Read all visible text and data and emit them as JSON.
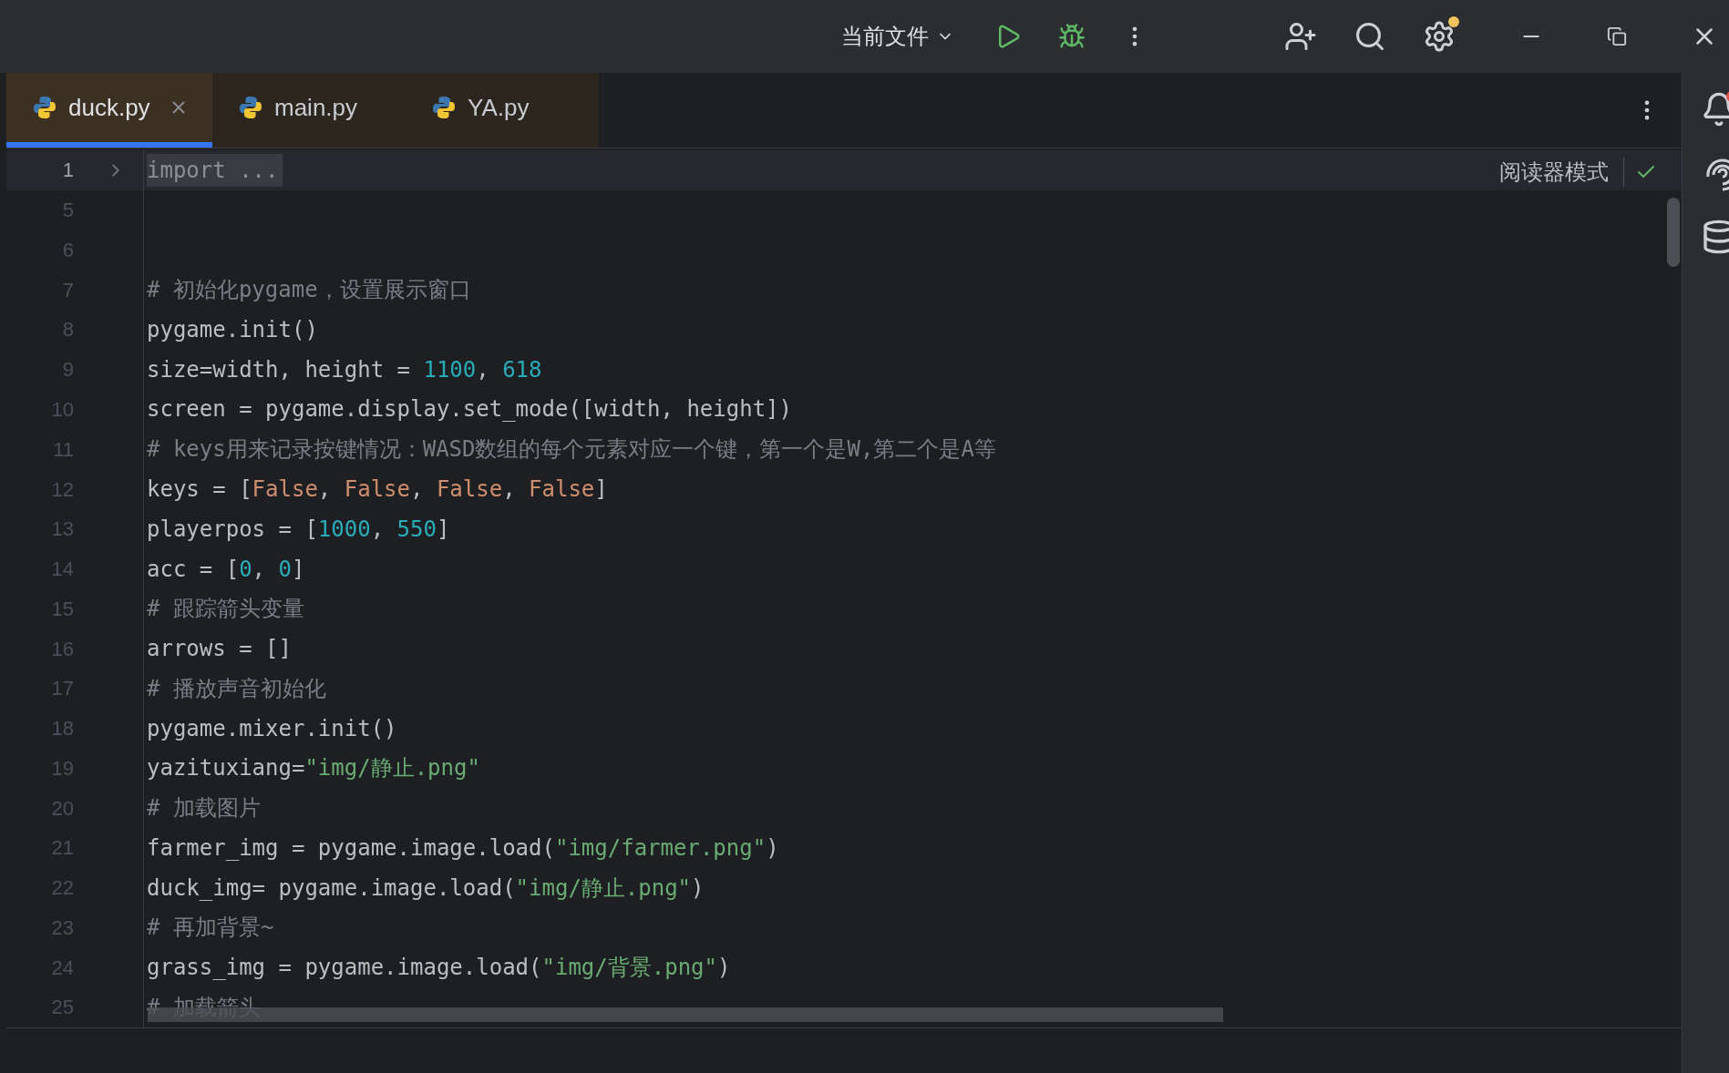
{
  "toolbar": {
    "run_config": "当前文件"
  },
  "tabs": [
    {
      "label": "duck.py",
      "selected": true
    },
    {
      "label": "main.py",
      "selected": false
    },
    {
      "label": "YA.py",
      "selected": false
    }
  ],
  "reader_mode": {
    "label": "阅读器模式"
  },
  "editor": {
    "lines": [
      {
        "number": "1",
        "current": true,
        "folded": true,
        "tokens": [
          {
            "kind": "folded",
            "text": "import ..."
          }
        ]
      },
      {
        "number": "5",
        "current": false,
        "folded": false
      },
      {
        "number": "6",
        "current": false,
        "folded": false
      },
      {
        "number": "7",
        "current": false,
        "folded": false,
        "tokens": [
          {
            "kind": "comment",
            "text": "# 初始化pygame，设置展示窗口"
          }
        ]
      },
      {
        "number": "8",
        "current": false,
        "folded": false,
        "tokens": [
          {
            "kind": "plain",
            "text": "pygame.init()"
          }
        ]
      },
      {
        "number": "9",
        "current": false,
        "folded": false,
        "tokens": [
          {
            "kind": "plain",
            "text": "size=width, height = "
          },
          {
            "kind": "number",
            "text": "1100"
          },
          {
            "kind": "plain",
            "text": ", "
          },
          {
            "kind": "number",
            "text": "618"
          }
        ]
      },
      {
        "number": "10",
        "current": false,
        "folded": false,
        "tokens": [
          {
            "kind": "plain",
            "text": "screen = pygame.display.set_mode([width, height])"
          }
        ]
      },
      {
        "number": "11",
        "current": false,
        "folded": false,
        "tokens": [
          {
            "kind": "comment",
            "text": "# keys用来记录按键情况：WASD数组的每个元素对应一个键，第一个是W,第二个是A等"
          }
        ]
      },
      {
        "number": "12",
        "current": false,
        "folded": false,
        "tokens": [
          {
            "kind": "plain",
            "text": "keys = ["
          },
          {
            "kind": "keyword",
            "text": "False"
          },
          {
            "kind": "plain",
            "text": ", "
          },
          {
            "kind": "keyword",
            "text": "False"
          },
          {
            "kind": "plain",
            "text": ", "
          },
          {
            "kind": "keyword",
            "text": "False"
          },
          {
            "kind": "plain",
            "text": ", "
          },
          {
            "kind": "keyword",
            "text": "False"
          },
          {
            "kind": "plain",
            "text": "]"
          }
        ]
      },
      {
        "number": "13",
        "current": false,
        "folded": false,
        "tokens": [
          {
            "kind": "plain",
            "text": "playerpos = ["
          },
          {
            "kind": "number",
            "text": "1000"
          },
          {
            "kind": "plain",
            "text": ", "
          },
          {
            "kind": "number",
            "text": "550"
          },
          {
            "kind": "plain",
            "text": "]"
          }
        ]
      },
      {
        "number": "14",
        "current": false,
        "folded": false,
        "tokens": [
          {
            "kind": "plain",
            "text": "acc = ["
          },
          {
            "kind": "number",
            "text": "0"
          },
          {
            "kind": "plain",
            "text": ", "
          },
          {
            "kind": "number",
            "text": "0"
          },
          {
            "kind": "plain",
            "text": "]"
          }
        ]
      },
      {
        "number": "15",
        "current": false,
        "folded": false,
        "tokens": [
          {
            "kind": "comment",
            "text": "# 跟踪箭头变量"
          }
        ]
      },
      {
        "number": "16",
        "current": false,
        "folded": false,
        "tokens": [
          {
            "kind": "plain",
            "text": "arrows = []"
          }
        ]
      },
      {
        "number": "17",
        "current": false,
        "folded": false,
        "tokens": [
          {
            "kind": "comment",
            "text": "# 播放声音初始化"
          }
        ]
      },
      {
        "number": "18",
        "current": false,
        "folded": false,
        "tokens": [
          {
            "kind": "plain",
            "text": "pygame.mixer.init()"
          }
        ]
      },
      {
        "number": "19",
        "current": false,
        "folded": false,
        "tokens": [
          {
            "kind": "plain",
            "text": "yazituxiang="
          },
          {
            "kind": "string",
            "text": "\"img/静止.png\""
          }
        ]
      },
      {
        "number": "20",
        "current": false,
        "folded": false,
        "tokens": [
          {
            "kind": "comment",
            "text": "# 加载图片"
          }
        ]
      },
      {
        "number": "21",
        "current": false,
        "folded": false,
        "tokens": [
          {
            "kind": "plain",
            "text": "farmer_img = pygame.image.load("
          },
          {
            "kind": "string",
            "text": "\"img/farmer.png\""
          },
          {
            "kind": "plain",
            "text": ")"
          }
        ]
      },
      {
        "number": "22",
        "current": false,
        "folded": false,
        "tokens": [
          {
            "kind": "plain",
            "text": "duck_img= pygame.image.load("
          },
          {
            "kind": "string",
            "text": "\"img/静止.png\""
          },
          {
            "kind": "plain",
            "text": ")"
          }
        ]
      },
      {
        "number": "23",
        "current": false,
        "folded": false,
        "tokens": [
          {
            "kind": "comment",
            "text": "# 再加背景~"
          }
        ]
      },
      {
        "number": "24",
        "current": false,
        "folded": false,
        "tokens": [
          {
            "kind": "plain",
            "text": "grass_img = pygame.image.load("
          },
          {
            "kind": "string",
            "text": "\"img/背景.png\""
          },
          {
            "kind": "plain",
            "text": ")"
          }
        ]
      },
      {
        "number": "25",
        "current": false,
        "folded": false,
        "tokens": [
          {
            "kind": "comment",
            "text": "# 加载箭头"
          }
        ]
      }
    ]
  }
}
